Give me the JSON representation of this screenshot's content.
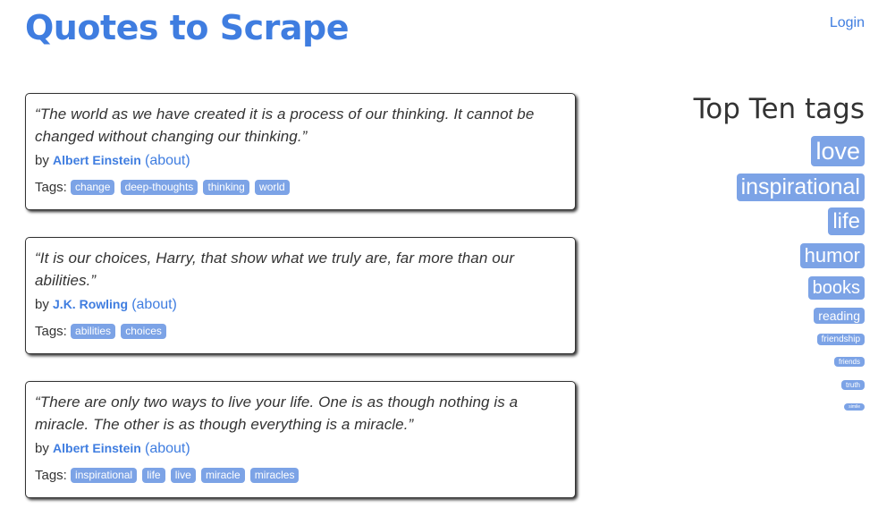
{
  "header": {
    "title": "Quotes to Scrape",
    "login_label": "Login"
  },
  "quotes": [
    {
      "text": "“The world as we have created it is a process of our thinking. It cannot be changed without changing our thinking.”",
      "by_label": "by",
      "author": "Albert Einstein",
      "about_label": "(about)",
      "tags_label": "Tags:",
      "tags": [
        "change",
        "deep-thoughts",
        "thinking",
        "world"
      ]
    },
    {
      "text": "“It is our choices, Harry, that show what we truly are, far more than our abilities.”",
      "by_label": "by",
      "author": "J.K. Rowling",
      "about_label": "(about)",
      "tags_label": "Tags:",
      "tags": [
        "abilities",
        "choices"
      ]
    },
    {
      "text": "“There are only two ways to live your life. One is as though nothing is a miracle. The other is as though everything is a miracle.”",
      "by_label": "by",
      "author": "Albert Einstein",
      "about_label": "(about)",
      "tags_label": "Tags:",
      "tags": [
        "inspirational",
        "life",
        "live",
        "miracle",
        "miracles"
      ]
    }
  ],
  "sidebar": {
    "title": "Top Ten tags",
    "tags": [
      "love",
      "inspirational",
      "life",
      "humor",
      "books",
      "reading",
      "friendship",
      "friends",
      "truth",
      "simile"
    ]
  },
  "colors": {
    "accent": "#3f7de0",
    "tag_background": "#7ca3e6",
    "text": "#333333"
  }
}
